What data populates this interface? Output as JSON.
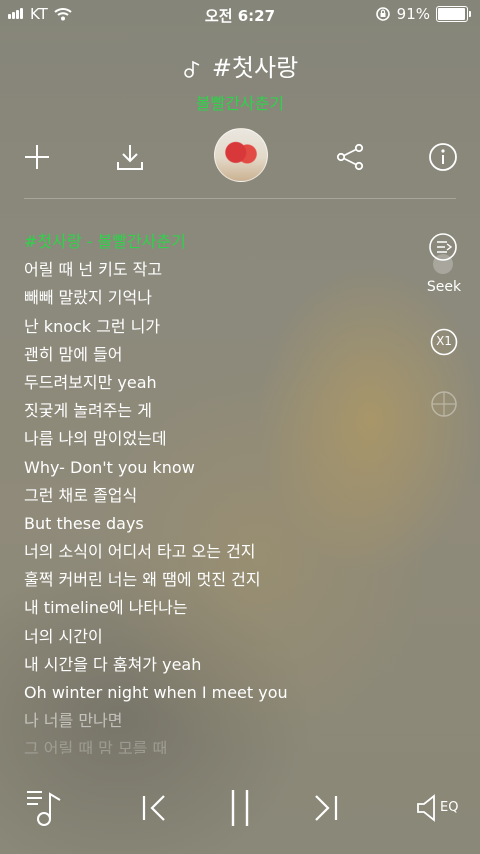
{
  "status_bar": {
    "carrier": "KT",
    "time": "오전 6:27",
    "battery_percent": "91%",
    "battery_level": 0.91,
    "icons": [
      "cellular-signal-icon",
      "wifi-icon",
      "orientation-lock-icon",
      "battery-icon"
    ]
  },
  "header": {
    "song_title": "#첫사랑",
    "artist": "볼빨간사춘기",
    "icons": [
      "music-note-icon"
    ]
  },
  "actions": {
    "items": [
      "add-icon",
      "download-icon",
      "album-art",
      "share-icon",
      "info-icon"
    ]
  },
  "lyrics": {
    "lines": [
      "#첫사랑 - 볼빨간사춘기",
      "어릴 때 넌 키도 작고",
      "빼빼 말랐지 기억나",
      "난 knock 그런 니가",
      "괜히 맘에 들어",
      "두드려보지만 yeah",
      "짓궂게 놀려주는 게",
      "나름 나의 맘이었는데",
      "Why- Don't you know",
      "그런 채로 졸업식",
      "But these days",
      "너의 소식이 어디서 타고 오는 건지",
      "훌쩍 커버린 너는 왜 땜에 멋진 건지",
      "내 timeline에 나타나는",
      "너의 시간이",
      "내 시간을 다 훔쳐가 yeah",
      "Oh winter night when I meet you",
      "나 너를 만나면",
      "그 어릴 때 맘 모를 때"
    ]
  },
  "side_controls": {
    "seek_label": "Seek",
    "speed_label": "X1",
    "icons": [
      "lyrics-scroll-icon",
      "toggle-switch",
      "speed-icon",
      "crosshair-icon"
    ]
  },
  "player": {
    "eq_label": "EQ",
    "icons": [
      "playlist-icon",
      "previous-icon",
      "pause-icon",
      "next-icon",
      "equalizer-icon"
    ]
  }
}
